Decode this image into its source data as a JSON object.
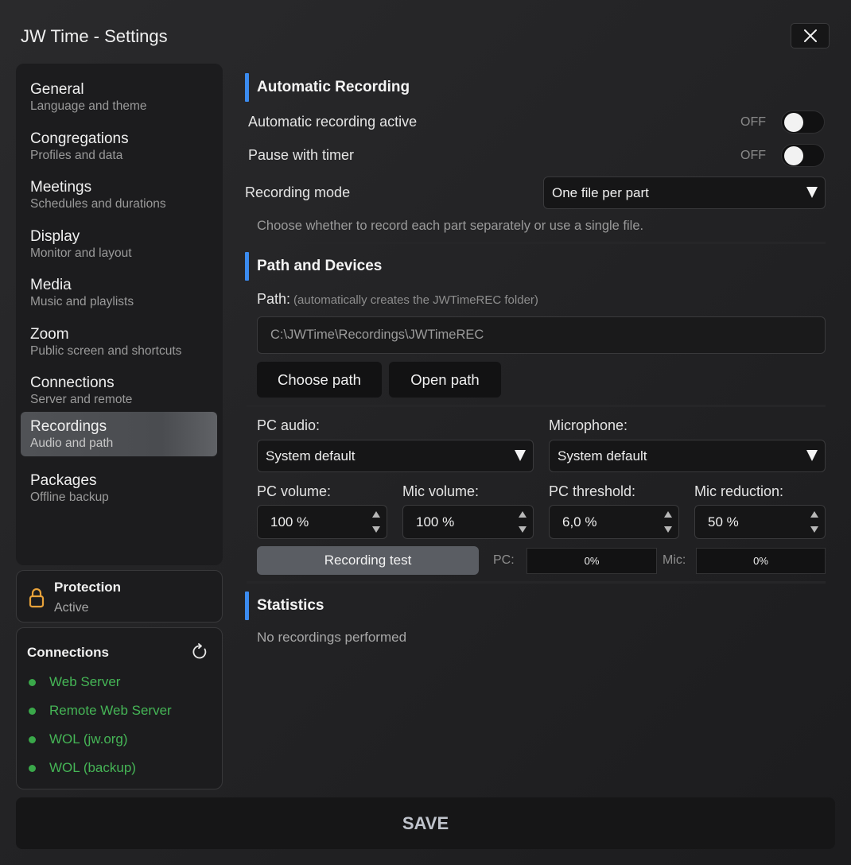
{
  "window": {
    "title": "JW Time - Settings"
  },
  "sidebar": {
    "items": [
      {
        "label": "General",
        "sub": "Language and theme"
      },
      {
        "label": "Congregations",
        "sub": "Profiles and data"
      },
      {
        "label": "Meetings",
        "sub": "Schedules and durations"
      },
      {
        "label": "Display",
        "sub": "Monitor and layout"
      },
      {
        "label": "Media",
        "sub": "Music and playlists"
      },
      {
        "label": "Zoom",
        "sub": "Public screen and shortcuts"
      },
      {
        "label": "Connections",
        "sub": "Server and remote"
      },
      {
        "label": "Recordings",
        "sub": "Audio and path"
      },
      {
        "label": "Packages",
        "sub": "Offline backup"
      }
    ],
    "active_index": 7
  },
  "protection": {
    "title": "Protection",
    "status": "Active"
  },
  "connections": {
    "title": "Connections",
    "items": [
      "Web Server",
      "Remote Web Server",
      "WOL (jw.org)",
      "WOL (backup)"
    ],
    "status_color": "#3aa84a"
  },
  "auto_recording": {
    "title": "Automatic Recording",
    "active_label": "Automatic recording active",
    "active_state": "OFF",
    "pause_label": "Pause with timer",
    "pause_state": "OFF",
    "mode_label": "Recording mode",
    "mode_value": "One file per part",
    "mode_hint": "Choose whether to record each part separately or use a single file."
  },
  "path_devices": {
    "title": "Path and Devices",
    "path_label": "Path:",
    "path_hint": "(automatically creates the JWTimeREC folder)",
    "path_value": "C:\\JWTime\\Recordings\\JWTimeREC",
    "choose_path": "Choose path",
    "open_path": "Open path",
    "pc_audio_label": "PC audio:",
    "pc_audio_value": "System default",
    "mic_label": "Microphone:",
    "mic_value": "System default",
    "pc_volume_label": "PC volume:",
    "pc_volume_value": "100 %",
    "mic_volume_label": "Mic volume:",
    "mic_volume_value": "100 %",
    "pc_threshold_label": "PC threshold:",
    "pc_threshold_value": "6,0 %",
    "mic_reduction_label": "Mic reduction:",
    "mic_reduction_value": "50 %",
    "test_button": "Recording test",
    "pc_meter_label": "PC:",
    "pc_meter_value": "0%",
    "mic_meter_label": "Mic:",
    "mic_meter_value": "0%"
  },
  "statistics": {
    "title": "Statistics",
    "empty_text": "No recordings performed"
  },
  "save_button": "SAVE",
  "colors": {
    "accent": "#3b8bef",
    "lock": "#e8a23a",
    "active_nav": "#505256"
  }
}
